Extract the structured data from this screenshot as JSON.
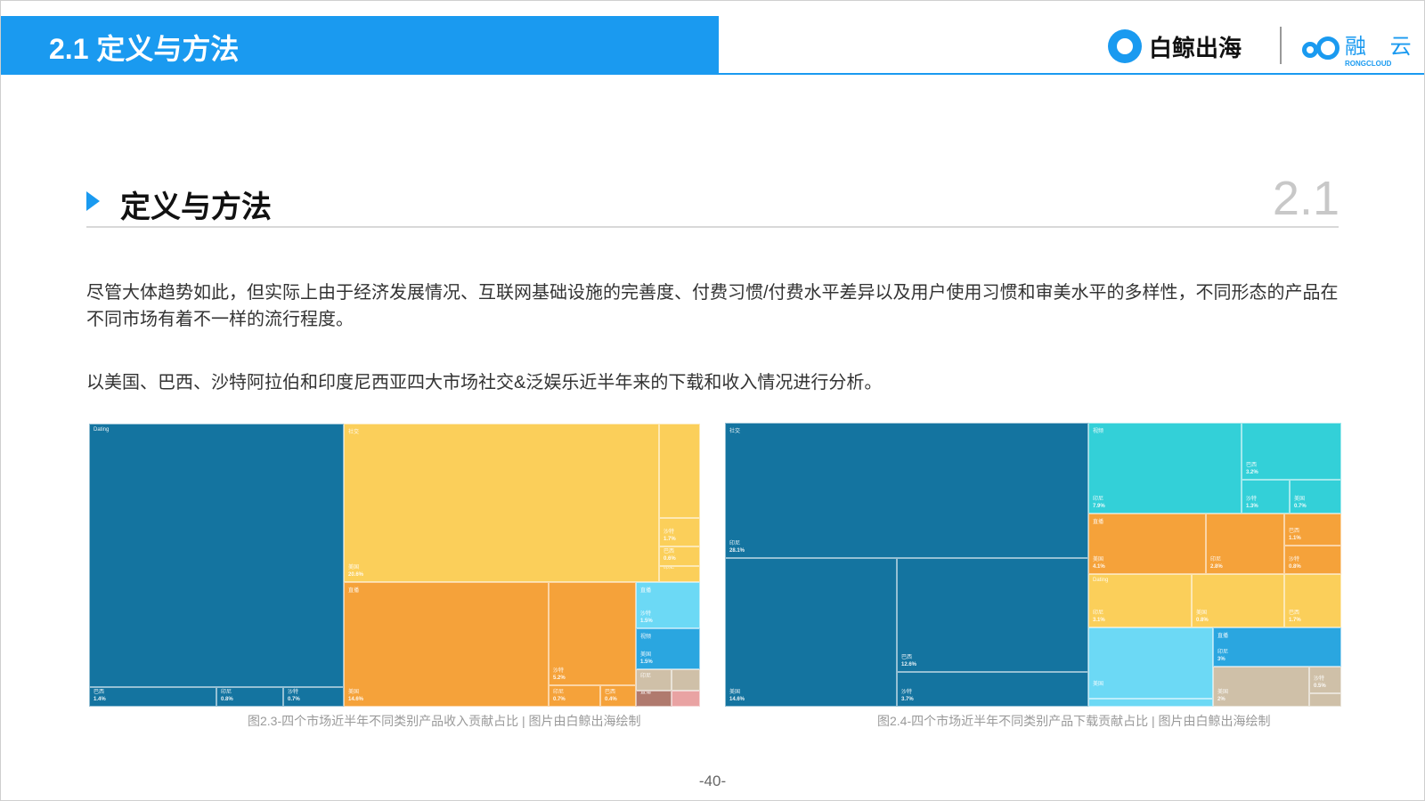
{
  "header": {
    "title": "2.1 定义与方法",
    "logo_baijing": "白鲸出海",
    "logo_rongyun": "融 云",
    "logo_rongyun_en": "RONGCLOUD"
  },
  "section": {
    "title": "定义与方法",
    "number": "2.1"
  },
  "paragraphs": [
    "尽管大体趋势如此，但实际上由于经济发展情况、互联网基础设施的完善度、付费习惯/付费水平差异以及用户使用习惯和审美水平的多样性，不同形态的产品在不同市场有着不一样的流行程度。",
    "以美国、巴西、沙特阿拉伯和印度尼西亚四大市场社交&泛娱乐近半年来的下载和收入情况进行分析。"
  ],
  "colors": {
    "accent": "#1a9af0",
    "dark_blue": "#1474a0",
    "yellow": "#fbcf5a",
    "orange": "#f5a23a",
    "light_blue": "#6cd9f5",
    "mid_blue": "#2aa6e0",
    "teal": "#33d0d8",
    "tan": "#cfc0a8",
    "brown": "#b07a6e"
  },
  "treemap_revenue": {
    "caption": "图2.3-四个市场近半年不同类别产品收入贡献占比 | 图片由白鲸出海绘制",
    "tiles": [
      {
        "name": "Dating",
        "label": "",
        "value": "",
        "color": "#1474a0"
      },
      {
        "name": "",
        "label": "美国",
        "value": "38.7%",
        "color": "#1474a0"
      },
      {
        "name": "",
        "label": "巴西",
        "value": "1.4%",
        "color": "#1474a0"
      },
      {
        "name": "",
        "label": "印尼",
        "value": "0.8%",
        "color": "#1474a0"
      },
      {
        "name": "",
        "label": "沙特",
        "value": "0.7%",
        "color": "#1474a0"
      },
      {
        "name": "社交",
        "label": "美国",
        "value": "20.6%",
        "color": "#fbcf5a"
      },
      {
        "name": "",
        "label": "",
        "value": "",
        "color": "#fbcf5a"
      },
      {
        "name": "",
        "label": "沙特",
        "value": "1.7%",
        "color": "#fbcf5a"
      },
      {
        "name": "",
        "label": "巴西",
        "value": "0.6%",
        "color": "#fbcf5a"
      },
      {
        "name": "",
        "label": "印尼",
        "value": "",
        "color": "#fbcf5a"
      },
      {
        "name": "直播",
        "label": "美国",
        "value": "14.6%",
        "color": "#f5a23a"
      },
      {
        "name": "",
        "label": "沙特",
        "value": "5.2%",
        "color": "#f5a23a"
      },
      {
        "name": "",
        "label": "印尼",
        "value": "0.7%",
        "color": "#f5a23a"
      },
      {
        "name": "",
        "label": "巴西",
        "value": "0.4%",
        "color": "#f5a23a"
      },
      {
        "name": "直播",
        "label": "沙特",
        "value": "1.5%",
        "color": "#6cd9f5"
      },
      {
        "name": "视频",
        "label": "美国",
        "value": "1.5%",
        "color": "#2aa6e0"
      },
      {
        "name": "",
        "label": "印尼",
        "value": "",
        "color": "#cfc0a8"
      },
      {
        "name": "",
        "label": "",
        "value": "",
        "color": "#cfc0a8"
      },
      {
        "name": "",
        "label": "直播",
        "value": "",
        "color": "#b07a6e"
      },
      {
        "name": "",
        "label": "",
        "value": "",
        "color": "#e9a3a3"
      }
    ]
  },
  "treemap_downloads": {
    "caption": "图2.4-四个市场近半年不同类别产品下载贡献占比 | 图片由白鲸出海绘制",
    "tiles": [
      {
        "name": "社交",
        "label": "印尼",
        "value": "28.1%",
        "color": "#1474a0"
      },
      {
        "name": "",
        "label": "美国",
        "value": "14.6%",
        "color": "#1474a0"
      },
      {
        "name": "",
        "label": "巴西",
        "value": "12.6%",
        "color": "#1474a0"
      },
      {
        "name": "",
        "label": "沙特",
        "value": "3.7%",
        "color": "#1474a0"
      },
      {
        "name": "视频",
        "label": "印尼",
        "value": "7.9%",
        "color": "#33d0d8"
      },
      {
        "name": "",
        "label": "巴西",
        "value": "3.2%",
        "color": "#33d0d8"
      },
      {
        "name": "",
        "label": "沙特",
        "value": "1.3%",
        "color": "#33d0d8"
      },
      {
        "name": "",
        "label": "美国",
        "value": "0.7%",
        "color": "#33d0d8"
      },
      {
        "name": "直播",
        "label": "美国",
        "value": "4.1%",
        "color": "#f5a23a"
      },
      {
        "name": "",
        "label": "印尼",
        "value": "2.8%",
        "color": "#f5a23a"
      },
      {
        "name": "",
        "label": "巴西",
        "value": "1.1%",
        "color": "#f5a23a"
      },
      {
        "name": "",
        "label": "沙特",
        "value": "0.8%",
        "color": "#f5a23a"
      },
      {
        "name": "Dating",
        "label": "印尼",
        "value": "3.1%",
        "color": "#fbcf5a"
      },
      {
        "name": "",
        "label": "美国",
        "value": "0.8%",
        "color": "#fbcf5a"
      },
      {
        "name": "",
        "label": "巴西",
        "value": "1.7%",
        "color": "#fbcf5a"
      },
      {
        "name": "",
        "label": "美国",
        "value": "",
        "color": "#6cd9f5"
      },
      {
        "name": "",
        "label": "巴西",
        "value": "4.6%",
        "color": "#6cd9f5"
      },
      {
        "name": "",
        "label": "沙特",
        "value": "",
        "color": "#6cd9f5"
      },
      {
        "name": "直播",
        "label": "印尼",
        "value": "3%",
        "color": "#2aa6e0"
      },
      {
        "name": "",
        "label": "美国",
        "value": "2%",
        "color": "#cfc0a8"
      },
      {
        "name": "",
        "label": "沙特",
        "value": "0.5%",
        "color": "#cfc0a8"
      },
      {
        "name": "",
        "label": "巴西",
        "value": "",
        "color": "#cfc0a8"
      }
    ]
  },
  "page_number": "-40-"
}
